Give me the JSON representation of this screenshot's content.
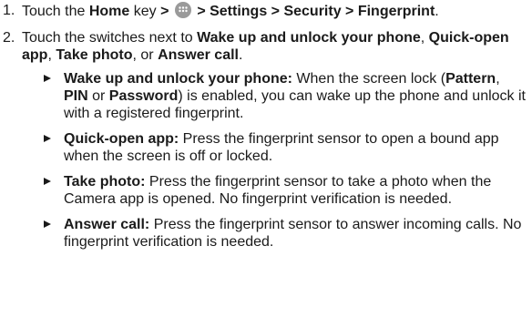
{
  "steps": [
    {
      "number": "1.",
      "touch": "Touch the ",
      "home_key": "Home",
      "key_text": " key ",
      "sep1": ">",
      "apps_icon": "apps-grid-icon",
      "path": " > Settings > Security > Fingerprint",
      "end": "."
    },
    {
      "number": "2.",
      "intro": "Touch the switches next to ",
      "opt1": "Wake up and unlock your phone",
      "c1": ", ",
      "opt2": "Quick-open app",
      "c2": ", ",
      "opt3": "Take photo",
      "c3": ", or ",
      "opt4": "Answer call",
      "end": "."
    }
  ],
  "bullets": [
    {
      "term": "Wake up and unlock your phone:",
      "t1": " When the screen lock (",
      "b1": "Pattern",
      "t2": ", ",
      "b2": "PIN",
      "t3": " or ",
      "b3": "Password",
      "t4": ") is enabled, you can wake up the phone and unlock it with a registered fingerprint."
    },
    {
      "term": "Quick-open app:",
      "text": " Press the fingerprint sensor to open a bound app when the screen is off or locked."
    },
    {
      "term": "Take photo:",
      "text": " Press the fingerprint sensor to take a photo when the Camera app is opened. No fingerprint verification is needed."
    },
    {
      "term": "Answer call:",
      "text": " Press the fingerprint sensor to answer incoming calls. No fingerprint verification is needed."
    }
  ]
}
